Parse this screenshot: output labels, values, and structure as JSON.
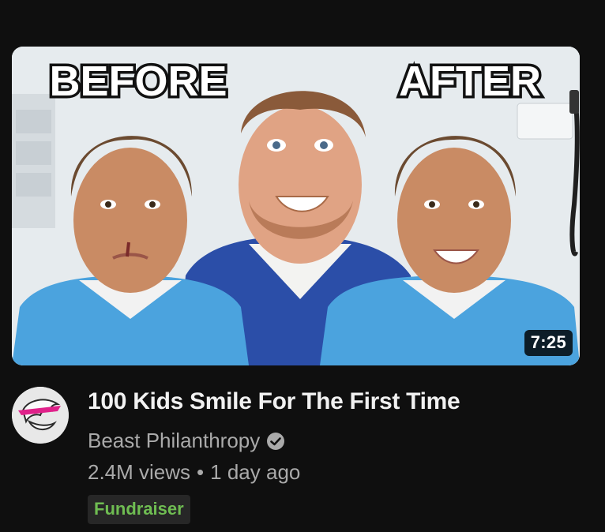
{
  "video": {
    "thumbnail": {
      "label_before": "BEFORE",
      "label_after": "AFTER",
      "duration": "7:25"
    },
    "title": "100 Kids Smile For The First Time",
    "channel": "Beast Philanthropy",
    "views": "2.4M views",
    "separator": "•",
    "age": "1 day ago",
    "badge": "Fundraiser"
  },
  "colors": {
    "background": "#0f0f0f",
    "title": "#f1f1f1",
    "secondary_text": "#aaaaaa",
    "badge_bg": "#272727",
    "badge_text": "#6fbd52"
  }
}
